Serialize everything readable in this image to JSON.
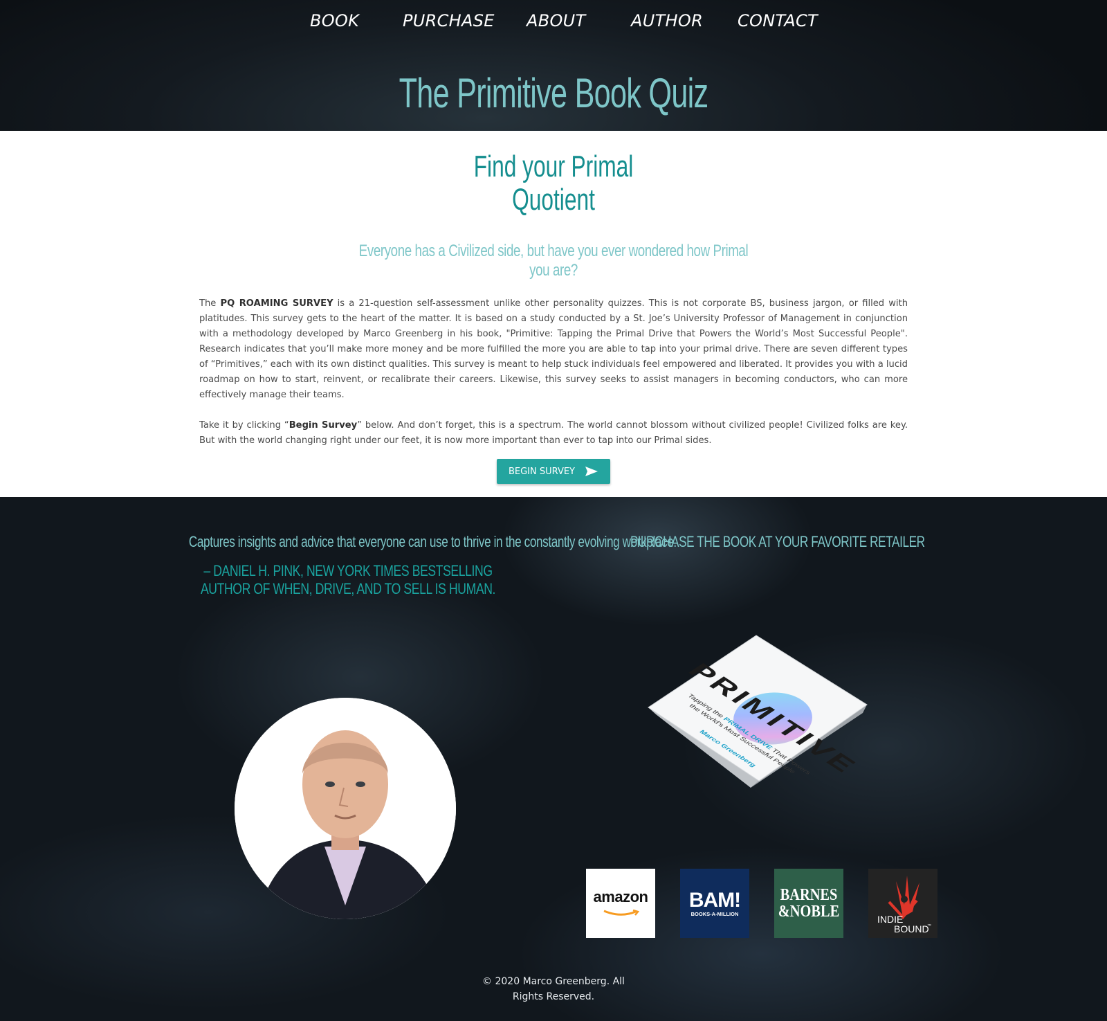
{
  "nav": {
    "items": [
      {
        "label": "BOOK"
      },
      {
        "label": "PURCHASE"
      },
      {
        "label": "ABOUT"
      },
      {
        "label": "AUTHOR"
      },
      {
        "label": "CONTACT"
      }
    ]
  },
  "header": {
    "title": "The Primitive Book Quiz"
  },
  "main": {
    "heading_line1": "Find your Primal",
    "heading_line2": "Quotient",
    "subheading_line1": "Everyone has a Civilized side, but have you ever wondered how Primal",
    "subheading_line2": "you are?",
    "p1_before": "The ",
    "p1_bold": "PQ ROAMING SURVEY",
    "p1_after": " is a 21-question self-assessment unlike other personality quizzes. This is not corporate BS, business jargon, or filled with platitudes. This survey gets to the heart of the matter. It is based on a study conducted by a St. Joe’s University Professor of Management in conjunction with a methodology developed by Marco Greenberg in his book, \"Primitive: Tapping the Primal Drive that Powers the World’s Most Successful People\". Research indicates that you’ll make more money and be more fulfilled the more you are able to tap into your primal drive. There are seven different types of “Primitives,” each with its own distinct qualities. This survey is meant to help stuck individuals feel empowered and liberated. It provides you with a lucid roadmap on how to start, reinvent, or recalibrate their careers. Likewise, this survey seeks to assist managers in becoming conductors, who can more effectively manage their teams.",
    "p2_before": "Take it by clicking “",
    "p2_bold": "Begin Survey",
    "p2_after": "” below. And don’t forget, this is a spectrum. The world cannot blossom without civilized people! Civilized folks are key. But with the world changing right under our feet, it is now more important than ever to tap into our Primal sides.",
    "button_label": "BEGIN SURVEY",
    "button_icon": "send-icon",
    "accent_color": "#24a59f"
  },
  "footer": {
    "quote": "Captures insights and advice that everyone can use to thrive in the constantly evolving workplace.",
    "quote_author": "– Daniel H. Pink, New York Times bestselling author of When, Drive, and To Sell Is Human.",
    "purchase_heading": "PURCHASE THE BOOK AT YOUR FAVORITE RETAILER",
    "book": {
      "title": "PRIMITIVE",
      "subtitle_before": "Tapping the ",
      "subtitle_highlight": "PRIMAL DRIVE",
      "subtitle_after": " That Powers",
      "subtitle_line2": "the World's Most Successful People",
      "author": "Marco Greenberg"
    },
    "retailers": [
      {
        "name": "amazon",
        "color": "#ffffff",
        "text_color": "#111111"
      },
      {
        "name": "BAM!",
        "sub": "BOOKS-A-MILLION",
        "color": "#0f2c5c",
        "text_color": "#ffffff"
      },
      {
        "name": "BARNES",
        "name2": "&NOBLE",
        "color": "#2e5f49",
        "text_color": "#ffffff"
      },
      {
        "name": "INDIE",
        "name2": "BOUND",
        "tm": "™",
        "color": "#232323",
        "text_color": "#ffffff"
      }
    ],
    "copyright_line1": "© 2020 Marco Greenberg. All",
    "copyright_line2": "Rights Reserved."
  }
}
